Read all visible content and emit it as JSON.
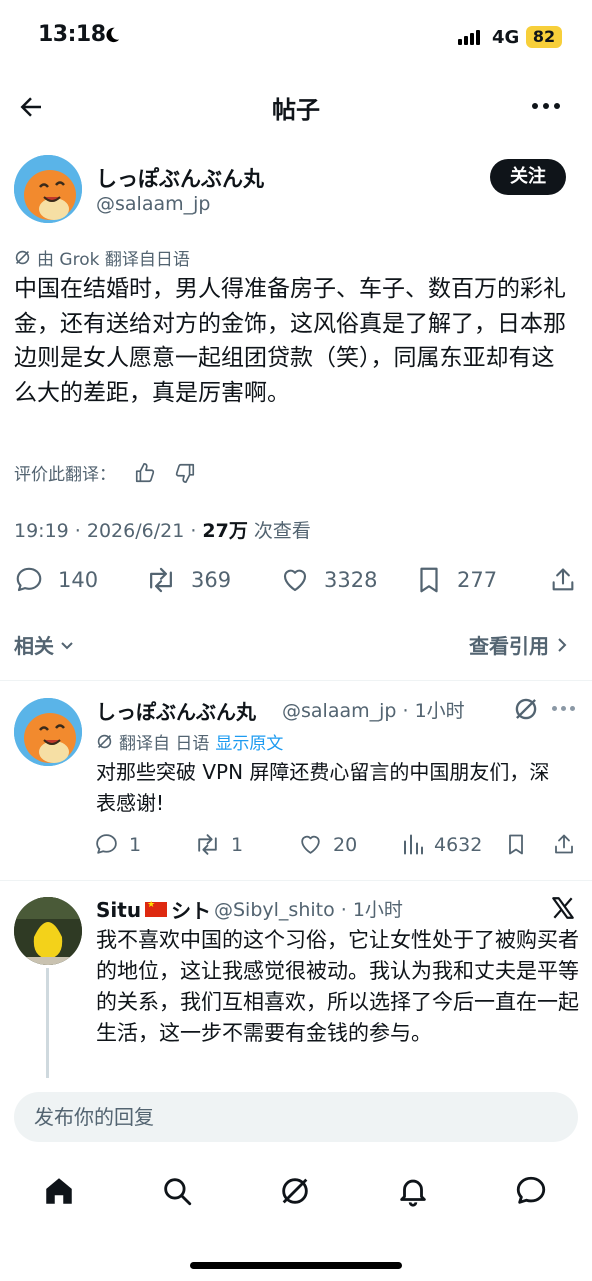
{
  "status_bar": {
    "time": "13:18",
    "network": "4G",
    "battery": "82"
  },
  "header": {
    "title": "帖子"
  },
  "post": {
    "author_name": "しっぽぶんぶん丸",
    "author_handle": "@salaam_jp",
    "follow_label": "关注",
    "translated_by": "由 Grok 翻译自日语",
    "body": "中国在结婚时，男人得准备房子、车子、数百万的彩礼金，还有送给对方的金饰，这风俗真是了解了，日本那边则是女人愿意一起组团贷款（笑），同属东亚却有这么大的差距，真是厉害啊。",
    "rate_translation_label": "评价此翻译：",
    "timestamp": "19:19 · 2026/6/21 · ",
    "views_count": "27万",
    "views_label": " 次查看",
    "stats": {
      "replies": "140",
      "reposts": "369",
      "likes": "3328",
      "bookmarks": "277"
    }
  },
  "sections": {
    "related_label": "相关",
    "quotes_label": "查看引用"
  },
  "replies": [
    {
      "author_name": "しっぽぶんぶん丸",
      "author_handle": "@salaam_jp · 1小时",
      "translated_label": "翻译自 日语",
      "show_original_label": "显示原文",
      "body": "对那些突破 VPN 屏障还费心留言的中国朋友们，深表感谢!",
      "stats": {
        "replies": "1",
        "reposts": "1",
        "likes": "20",
        "views": "4632"
      }
    },
    {
      "author_name_prefix": "Situ",
      "author_name_suffix": "シト",
      "author_handle": "@Sibyl_shito · 1小时",
      "body": "我不喜欢中国的这个习俗，它让女性处于了被购买者的地位，这让我感觉很被动。我认为我和丈夫是平等的关系，我们互相喜欢，所以选择了今后一直在一起生活，这一步不需要有金钱的参与。"
    }
  ],
  "reply_bar": {
    "placeholder": "发布你的回复"
  },
  "colors": {
    "accent": "#1d9bf0",
    "text": "#0f1419",
    "muted": "#536471",
    "battery": "#f7cf3a"
  }
}
